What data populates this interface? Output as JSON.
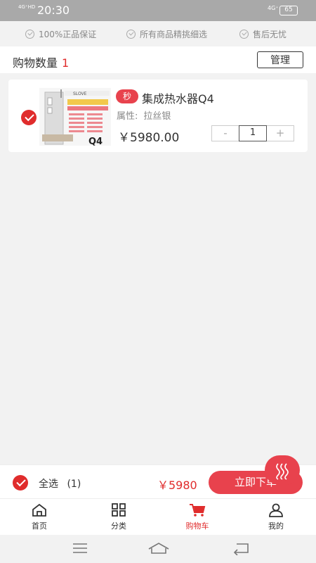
{
  "status_bar": {
    "network_left": "4G⁺HD",
    "time": "20:30",
    "network_right": "4G⁺",
    "battery": "65"
  },
  "guarantees": [
    {
      "label": "100%正品保证",
      "icon": "check-circle-icon"
    },
    {
      "label": "所有商品精挑细选",
      "icon": "check-circle-icon"
    },
    {
      "label": "售后无忧",
      "icon": "check-circle-icon"
    }
  ],
  "header": {
    "title": "购物数量",
    "count": "1",
    "manage_label": "管理"
  },
  "cart_item": {
    "badge": "秒",
    "name": "集成热水器Q4",
    "attr_label": "属性:",
    "attr_value": "拉丝银",
    "price": "￥5980.00",
    "minus": "-",
    "quantity": "1",
    "plus": "+",
    "selected": true,
    "image_caption": "Q4"
  },
  "summary": {
    "select_all": "全选",
    "select_count": "(1)",
    "total": "￥5980",
    "checkout_label": "立即下单"
  },
  "tabs": [
    {
      "label": "首页",
      "icon": "home-icon",
      "active": false
    },
    {
      "label": "分类",
      "icon": "grid-icon",
      "active": false
    },
    {
      "label": "购物车",
      "icon": "cart-icon",
      "active": true
    },
    {
      "label": "我的",
      "icon": "user-icon",
      "active": false
    }
  ],
  "colors": {
    "accent": "#e8424d",
    "price_red": "#e02c2c",
    "status_bar": "#a9a9a9",
    "background": "#f2f2f2"
  }
}
